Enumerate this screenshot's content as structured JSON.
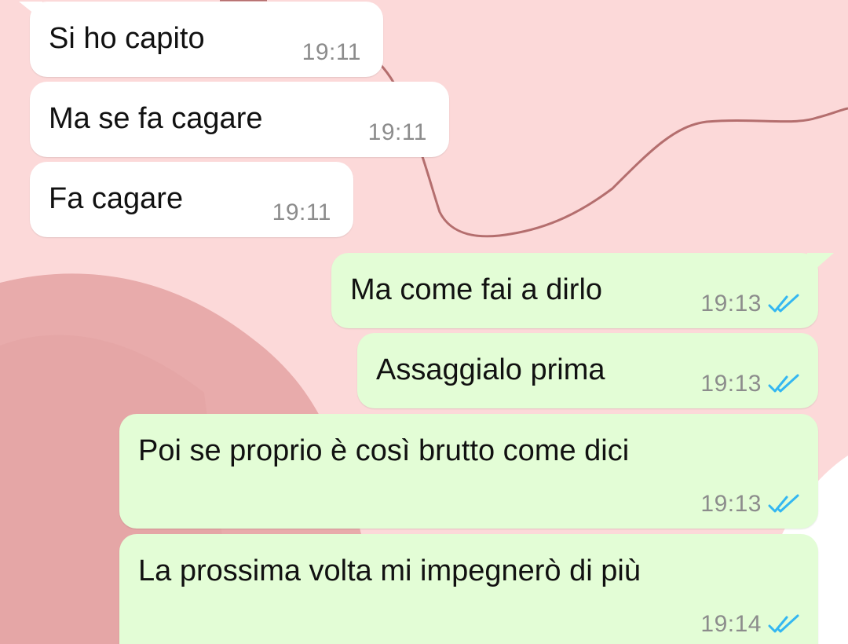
{
  "theme": {
    "incoming_bubble": "#ffffff",
    "outgoing_bubble": "#e3fdd6",
    "timestamp_color": "#8c8c8c",
    "read_receipt_color": "#34b7f1",
    "wallpaper": "pink abstract"
  },
  "messages": [
    {
      "direction": "incoming",
      "text": "Si ho capito",
      "time": "19:11"
    },
    {
      "direction": "incoming",
      "text": "Ma se fa cagare",
      "time": "19:11"
    },
    {
      "direction": "incoming",
      "text": "Fa cagare",
      "time": "19:11"
    },
    {
      "direction": "outgoing",
      "text": "Ma come fai a dirlo",
      "time": "19:13",
      "status_icon": "double-check-read-icon"
    },
    {
      "direction": "outgoing",
      "text": "Assaggialo prima",
      "time": "19:13",
      "status_icon": "double-check-read-icon"
    },
    {
      "direction": "outgoing",
      "text": "Poi se proprio è così brutto come dici",
      "time": "19:13",
      "status_icon": "double-check-read-icon"
    },
    {
      "direction": "outgoing",
      "text": "La prossima volta mi impegnerò di più",
      "time": "19:14",
      "status_icon": "double-check-read-icon"
    }
  ]
}
